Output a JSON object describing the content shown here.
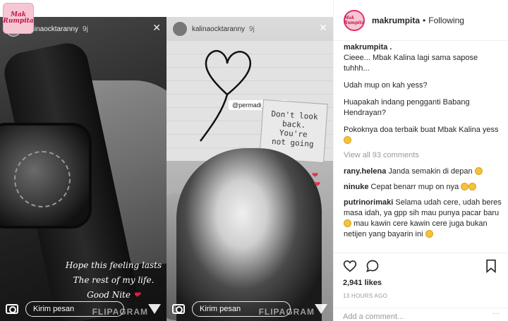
{
  "post": {
    "username": "makrumpita",
    "separator": "•",
    "follow_state": "Following",
    "brand_text": "Mak Rumpita"
  },
  "stories": {
    "left": {
      "username": "kalinaocktaranny",
      "age": "9j",
      "caption_line1": "Hope this feeling lasts",
      "caption_line2": "The rest of my life.",
      "caption_line3": "Good Nite",
      "reply_placeholder": "Kirim pesan",
      "watermark": "FLIPAGRAM"
    },
    "right": {
      "username": "kalinaocktaranny",
      "age": "9j",
      "mention": "@permadi_suryaa",
      "sign_text_1": "Don't look",
      "sign_text_2": "back.",
      "sign_text_3": "You're",
      "sign_text_4": "not going",
      "reply_placeholder": "Kirim pesan",
      "watermark": "FLIPAGRAM"
    }
  },
  "caption": {
    "username": "makrumpita .",
    "lines": [
      "Cieee... Mbak Kalina lagi sama sapose tuhhh...",
      "Udah mup on kah yess?",
      "Huapakah indang pengganti Babang Hendrayan?",
      "Pokoknya doa terbaik buat Mbak Kalina yess"
    ]
  },
  "view_all": "View all 93 comments",
  "comments": [
    {
      "user": "rany.helena",
      "text": "Janda semakin di depan"
    },
    {
      "user": "ninuke",
      "text": "Cepat benarr mup on nya"
    },
    {
      "user": "putrinorimaki",
      "text": "Selama udah cere, udah beres masa idah, ya gpp sih mau punya pacar baru",
      "text2": "mau kawin cere kawin cere juga bukan netijen yang bayarin ini"
    }
  ],
  "likes": "2,941 likes",
  "time_ago": "13 HOURS AGO",
  "add_comment_placeholder": "Add a comment...",
  "more": "···",
  "colors": {
    "accent_pink": "#e1306c",
    "text_dark": "#262626",
    "muted": "#999999"
  },
  "icons": [
    "heart-icon",
    "comment-icon",
    "bookmark-icon",
    "camera-icon",
    "send-icon",
    "close-icon"
  ]
}
